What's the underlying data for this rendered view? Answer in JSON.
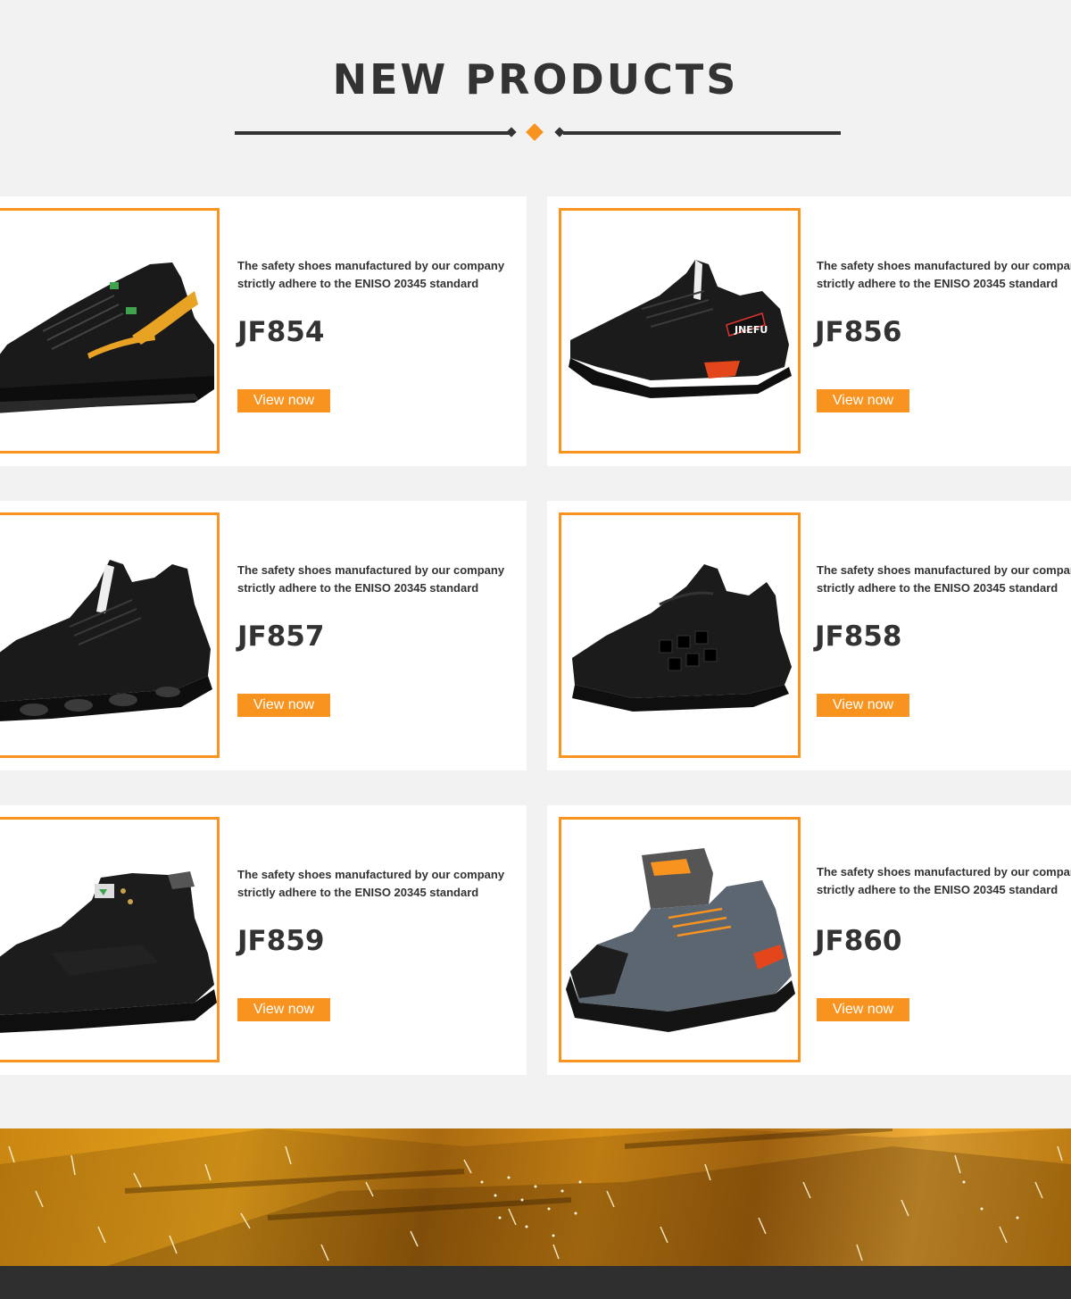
{
  "header": {
    "title": "NEW PRODUCTS"
  },
  "colors": {
    "accent": "#f7931e",
    "dark": "#333333",
    "background": "#f2f2f2"
  },
  "products": [
    {
      "description_line1": "The safety shoes manufactured by our company",
      "description_line2": "strictly adhere to the ENISO 20345 standard",
      "code": "JF854",
      "button_label": "View now",
      "image_icon": "black-yellow-sneaker"
    },
    {
      "description_line1": "The safety shoes manufactured by our company",
      "description_line2": "strictly adhere to the ENISO 20345 standard",
      "code": "JF856",
      "button_label": "View now",
      "image_icon": "black-mesh-sneaker"
    },
    {
      "description_line1": "The safety shoes manufactured by our company",
      "description_line2": "strictly adhere to the ENISO 20345 standard",
      "code": "JF857",
      "button_label": "View now",
      "image_icon": "black-knit-sneaker"
    },
    {
      "description_line1": "The safety shoes manufactured by our company",
      "description_line2": "strictly adhere to the ENISO 20345 standard",
      "code": "JF858",
      "button_label": "View now",
      "image_icon": "black-sport-sneaker"
    },
    {
      "description_line1": "The safety shoes manufactured by our company",
      "description_line2": "strictly adhere to the ENISO 20345 standard",
      "code": "JF859",
      "button_label": "View now",
      "image_icon": "black-leather-boot"
    },
    {
      "description_line1": "The safety shoes manufactured by our company",
      "description_line2": "strictly adhere to the ENISO 20345 standard",
      "code": "JF860",
      "button_label": "View now",
      "image_icon": "grey-hiking-shoe"
    }
  ]
}
